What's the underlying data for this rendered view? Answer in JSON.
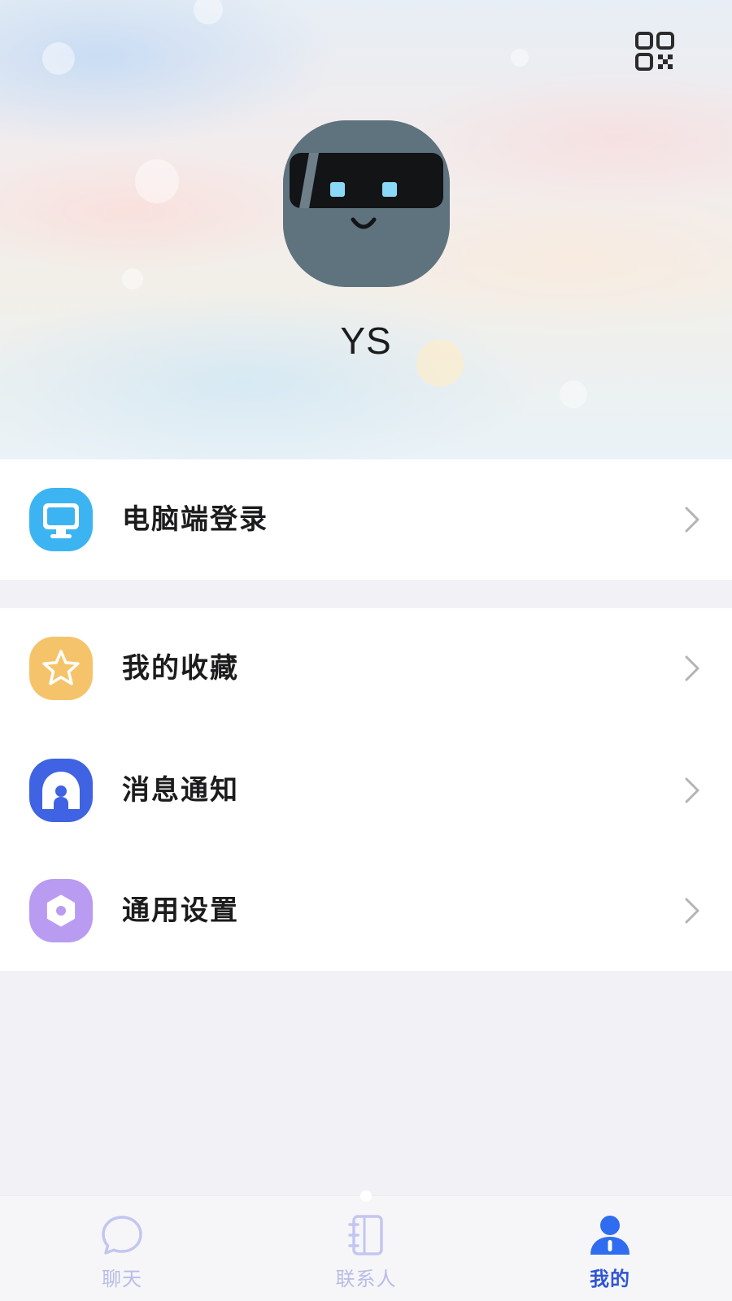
{
  "profile": {
    "username": "YS",
    "qr_icon": "qr-code-icon",
    "avatar_icon": "robot-avatar"
  },
  "menu": {
    "group1": [
      {
        "label": "电脑端登录",
        "icon": "computer-icon",
        "color": "#3db4f2"
      }
    ],
    "group2": [
      {
        "label": "我的收藏",
        "icon": "star-icon",
        "color": "#f5c46a"
      },
      {
        "label": "消息通知",
        "icon": "notification-icon",
        "color": "#3f63e3"
      },
      {
        "label": "通用设置",
        "icon": "settings-icon",
        "color": "#b99cf2"
      }
    ]
  },
  "tabs": [
    {
      "label": "聊天",
      "icon": "chat-bubble-icon",
      "active": false
    },
    {
      "label": "联系人",
      "icon": "contacts-book-icon",
      "active": false
    },
    {
      "label": "我的",
      "icon": "person-icon",
      "active": true
    }
  ],
  "colors": {
    "background": "#f2f2f6",
    "active_tab": "#2f55d4",
    "inactive_tab": "#b9bce6",
    "avatar": "#5f737f"
  }
}
